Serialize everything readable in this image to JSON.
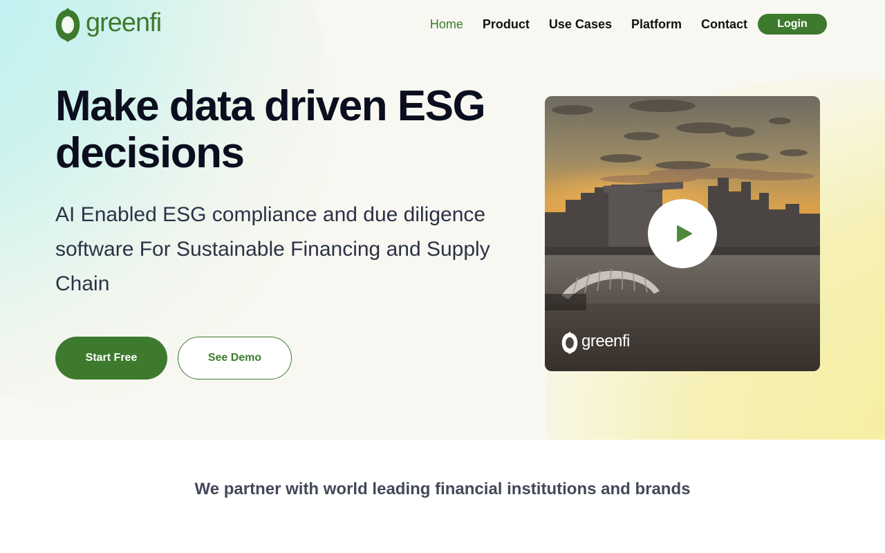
{
  "brand": {
    "name": "greenfi",
    "primary_color": "#3d7a2e",
    "logo_icon": "greenfi-logo-icon"
  },
  "nav": {
    "links": [
      {
        "label": "Home",
        "active": true
      },
      {
        "label": "Product",
        "active": false
      },
      {
        "label": "Use Cases",
        "active": false
      },
      {
        "label": "Platform",
        "active": false
      },
      {
        "label": "Contact",
        "active": false
      }
    ],
    "login_label": "Login"
  },
  "hero": {
    "headline": "Make data driven ESG decisions",
    "subheadline": "AI Enabled ESG compliance and due diligence software For Sustainable Financing and Supply Chain",
    "primary_cta": "Start Free",
    "secondary_cta": "See Demo"
  },
  "video": {
    "thumbnail": "singapore-skyline-sunset",
    "play_icon": "play-icon",
    "watermark": "greenfi"
  },
  "partners": {
    "heading": "We partner with world leading financial institutions and brands"
  }
}
